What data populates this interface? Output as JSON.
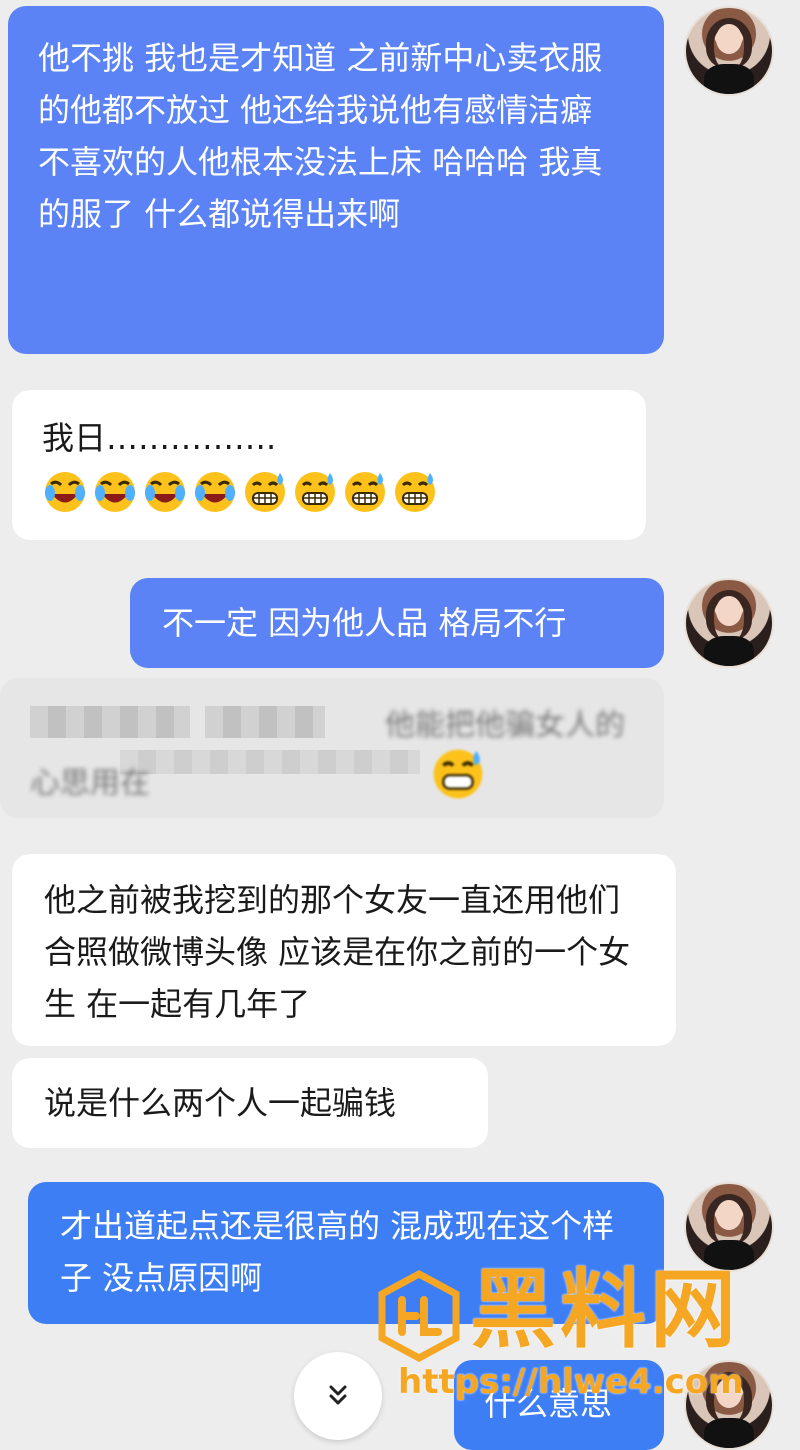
{
  "messages": [
    {
      "id": "m1",
      "side": "mine",
      "text": "他不挑 我也是才知道 之前新中心卖衣服的他都不放过 他还给我说他有感情洁癖 不喜欢的人他根本没法上床 哈哈哈 我真的服了 什么都说得出来啊"
    },
    {
      "id": "m2",
      "side": "theirs",
      "text": "我日…………….",
      "emojis": [
        "rofl-emoji",
        "rofl-emoji",
        "rofl-emoji",
        "rofl-emoji",
        "grin-sweat-emoji",
        "grin-sweat-emoji",
        "grin-sweat-emoji",
        "grin-sweat-emoji"
      ]
    },
    {
      "id": "m3",
      "side": "mine",
      "text": "不一定 因为他人品 格局不行"
    },
    {
      "id": "m4",
      "side": "theirs",
      "text_line1": "他能把他骗女人的",
      "text_line2": "心思用在"
    },
    {
      "id": "m5",
      "side": "theirs",
      "text": "他之前被我挖到的那个女友一直还用他们合照做微博头像 应该是在你之前的一个女生 在一起有几年了"
    },
    {
      "id": "m6",
      "side": "theirs",
      "text": "说是什么两个人一起骗钱"
    },
    {
      "id": "m7",
      "side": "mine",
      "text": "才出道起点还是很高的 混成现在这个样子 没点原因啊"
    },
    {
      "id": "m8",
      "side": "mine",
      "text": "什么意思"
    }
  ],
  "watermark": {
    "brand": "黑料网",
    "url": "https://hlwe4.com",
    "color": "#f5a623"
  },
  "colors": {
    "mine_bubble": "#5b83f5",
    "theirs_bubble": "#ffffff",
    "background": "#ededed"
  },
  "scroll_button": {
    "icon": "double-chevron-down-icon"
  }
}
